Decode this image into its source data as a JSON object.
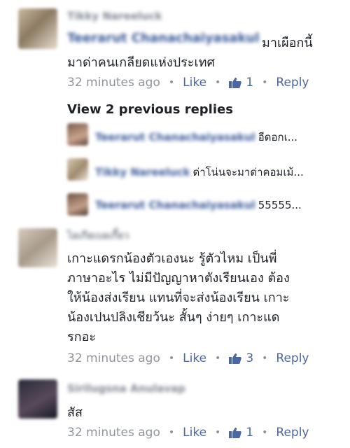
{
  "comments": [
    {
      "author": "Tikky Nareeluck",
      "mention": "Teerarut Chanachaiyasakul",
      "text_line1": "มาเผือกนี้",
      "text_line2": "มาด่าคนเกลียดแห่งประเทศ",
      "time": "32 minutes ago",
      "like_label": "Like",
      "like_count": "1",
      "reply_label": "Reply"
    },
    {
      "author": "ไอเกียเบอเกี้ยว",
      "lines": [
        "เกาะแดรกน้องตัวเองนะ รู้ตัวไหม เป็นพี่",
        "ภาษาอะไร ไม่มีปัญญาหาตังเรียนเอง ต้อง",
        "ให้น้องส่งเรียน แทนที่จะส่งน้องเรียน เกาะ",
        "น้องเปนปลิงเชียว้นะ สั้นๆ ง่ายๆ เกาะแด",
        "รกอะ"
      ],
      "time": "32 minutes ago",
      "like_label": "Like",
      "like_count": "3",
      "reply_label": "Reply"
    },
    {
      "author": "Sirilugsna Anulavap",
      "text": "สัส",
      "time": "32 minutes ago",
      "like_label": "Like",
      "like_count": "1",
      "reply_label": "Reply"
    }
  ],
  "view_previous": "View 2 previous replies",
  "replies": [
    {
      "name": "Teerarut Chanachaiyasakul",
      "text": "อีดอกเ..."
    },
    {
      "name": "Tikky Nareeluck",
      "text": "ด่าโน่นจะมาด่าคอมเม้..."
    },
    {
      "name": "Teerarut Chanachaiyasakul",
      "text": "55555..."
    }
  ],
  "colors": {
    "link": "#4b67a1",
    "meta": "#90949c",
    "name": "#385898"
  }
}
